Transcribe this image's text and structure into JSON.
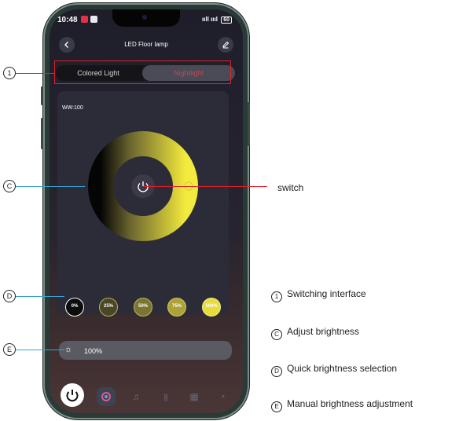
{
  "status_bar": {
    "time": "10:48",
    "signal_text": "ııll ıııl",
    "battery": "60"
  },
  "app": {
    "title": "LED Floor lamp",
    "back_icon": "chevron-left-icon",
    "edit_icon": "pencil-icon",
    "tabs": [
      {
        "label": "Colored Light",
        "selected": false
      },
      {
        "label": "Nightlight",
        "selected": true
      }
    ],
    "ww_label": "WW:100",
    "presets": [
      "0%",
      "25%",
      "50%",
      "75%",
      "100%"
    ],
    "brightness_text": "100%",
    "power_glyph": "⏻",
    "nav_icons": [
      "palette-icon",
      "music-icon",
      "sliders-icon",
      "scene-icon",
      "timer-icon"
    ],
    "accent_color": "#e6dc3c",
    "nightlight_tab_color": "#b84a5a"
  },
  "annotations": {
    "markers": [
      "1",
      "C",
      "D",
      "E"
    ],
    "switch_label": "switch",
    "legend": [
      {
        "marker": "1",
        "text": "Switching interface"
      },
      {
        "marker": "C",
        "text": "Adjust brightness"
      },
      {
        "marker": "D",
        "text": "Quick brightness selection"
      },
      {
        "marker": "E",
        "text": "Manual brightness adjustment"
      }
    ]
  }
}
